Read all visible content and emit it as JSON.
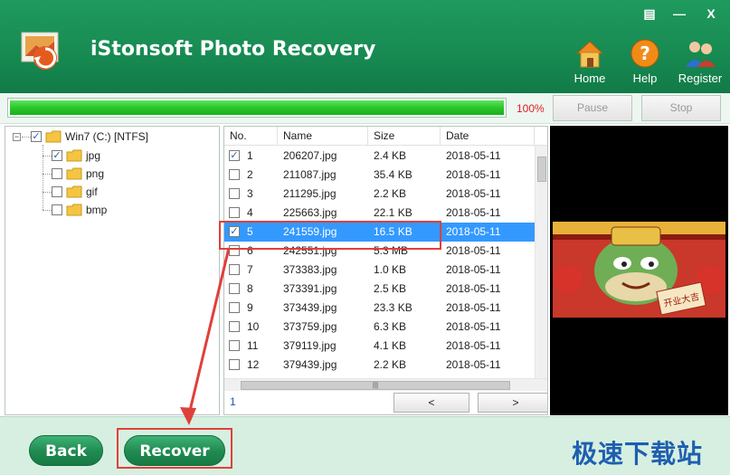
{
  "app": {
    "title": "iStonsoft Photo Recovery"
  },
  "window_controls": {
    "menu": "▤",
    "minimize": "—",
    "close": "X"
  },
  "header_buttons": [
    {
      "label": "Home",
      "icon": "home-icon"
    },
    {
      "label": "Help",
      "icon": "help-icon"
    },
    {
      "label": "Register",
      "icon": "register-icon"
    }
  ],
  "progress": {
    "percent_label": "100%",
    "value": 1.0,
    "pause_label": "Pause",
    "stop_label": "Stop"
  },
  "tree": {
    "root_label": "Win7 (C:) [NTFS]",
    "root_checked": true,
    "children": [
      {
        "label": "jpg",
        "checked": true
      },
      {
        "label": "png",
        "checked": false
      },
      {
        "label": "gif",
        "checked": false
      },
      {
        "label": "bmp",
        "checked": false
      }
    ]
  },
  "file_list": {
    "columns": [
      "No.",
      "Name",
      "Size",
      "Date"
    ],
    "rows": [
      {
        "no": "1",
        "name": "206207.jpg",
        "size": "2.4 KB",
        "date": "2018-05-11",
        "checked": true,
        "selected": false
      },
      {
        "no": "2",
        "name": "211087.jpg",
        "size": "35.4 KB",
        "date": "2018-05-11",
        "checked": false,
        "selected": false
      },
      {
        "no": "3",
        "name": "211295.jpg",
        "size": "2.2 KB",
        "date": "2018-05-11",
        "checked": false,
        "selected": false
      },
      {
        "no": "4",
        "name": "225663.jpg",
        "size": "22.1 KB",
        "date": "2018-05-11",
        "checked": false,
        "selected": false
      },
      {
        "no": "5",
        "name": "241559.jpg",
        "size": "16.5 KB",
        "date": "2018-05-11",
        "checked": true,
        "selected": true
      },
      {
        "no": "6",
        "name": "242551.jpg",
        "size": "5.3 MB",
        "date": "2018-05-11",
        "checked": false,
        "selected": false
      },
      {
        "no": "7",
        "name": "373383.jpg",
        "size": "1.0 KB",
        "date": "2018-05-11",
        "checked": false,
        "selected": false
      },
      {
        "no": "8",
        "name": "373391.jpg",
        "size": "2.5 KB",
        "date": "2018-05-11",
        "checked": false,
        "selected": false
      },
      {
        "no": "9",
        "name": "373439.jpg",
        "size": "23.3 KB",
        "date": "2018-05-11",
        "checked": false,
        "selected": false
      },
      {
        "no": "10",
        "name": "373759.jpg",
        "size": "6.3 KB",
        "date": "2018-05-11",
        "checked": false,
        "selected": false
      },
      {
        "no": "11",
        "name": "379119.jpg",
        "size": "4.1 KB",
        "date": "2018-05-11",
        "checked": false,
        "selected": false
      },
      {
        "no": "12",
        "name": "379439.jpg",
        "size": "2.2 KB",
        "date": "2018-05-11",
        "checked": false,
        "selected": false
      }
    ],
    "page_number": "1",
    "prev_label": "<",
    "next_label": ">",
    "hscroll_grip": "|||"
  },
  "preview": {
    "caption": "开业大吉"
  },
  "footer": {
    "back_label": "Back",
    "recover_label": "Recover",
    "watermark": "极速下载站"
  },
  "colors": {
    "header_green": "#1b9257",
    "selection_blue": "#3399ff",
    "annotation_red": "#e0403a",
    "percent_red": "#e02020"
  }
}
